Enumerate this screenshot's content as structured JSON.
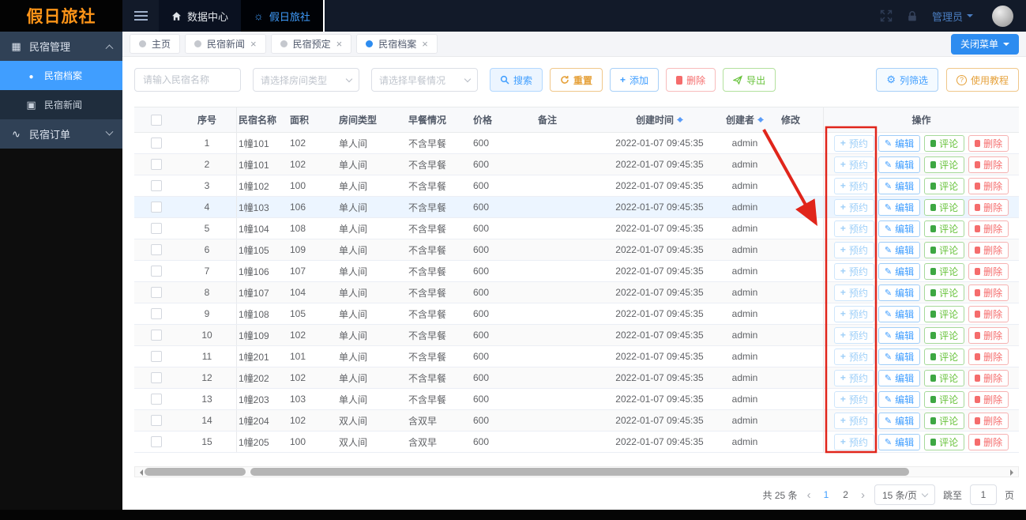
{
  "topbar": {
    "logo": "假日旅社",
    "nav": [
      {
        "label": "数据中心",
        "icon": "home-icon"
      },
      {
        "label": "假日旅社",
        "icon": "sun-icon"
      }
    ],
    "user_label": "管理员"
  },
  "sidebar": {
    "items": [
      {
        "label": "民宿管理",
        "icon": "grid-icon",
        "state": "expanded"
      },
      {
        "label": "民宿档案",
        "icon": "circle-icon",
        "active": true
      },
      {
        "label": "民宿新闻",
        "icon": "news-icon",
        "active": false
      },
      {
        "label": "民宿订单",
        "icon": "pulse-icon",
        "state": "collapsed"
      }
    ]
  },
  "tabsbar": {
    "tabs": [
      {
        "label": "主页",
        "closable": false,
        "active": false
      },
      {
        "label": "民宿新闻",
        "closable": true,
        "active": false
      },
      {
        "label": "民宿预定",
        "closable": true,
        "active": false
      },
      {
        "label": "民宿档案",
        "closable": true,
        "active": true
      }
    ],
    "close_menu_label": "关闭菜单"
  },
  "filters": {
    "name_placeholder": "请输入民宿名称",
    "room_type_placeholder": "请选择房间类型",
    "breakfast_placeholder": "请选择早餐情况",
    "search": "搜索",
    "reset": "重置",
    "add": "添加",
    "delete": "删除",
    "export": "导出",
    "column_filter": "列筛选",
    "tutorial": "使用教程"
  },
  "table": {
    "headers": [
      "序号",
      "民宿名称",
      "面积",
      "房间类型",
      "早餐情况",
      "价格",
      "备注",
      "创建时间",
      "创建者",
      "修改",
      "操作"
    ],
    "actions": {
      "reserve": "预约",
      "edit": "编辑",
      "comment": "评论",
      "del": "删除"
    },
    "rows": [
      {
        "index": "1",
        "name": "1幢101",
        "area": "102",
        "room": "单人间",
        "breakfast": "不含早餐",
        "price": "600",
        "remark": "",
        "created": "2022-01-07 09:45:35",
        "creator": "admin",
        "modified": "",
        "highlight": false
      },
      {
        "index": "2",
        "name": "1幢101",
        "area": "102",
        "room": "单人间",
        "breakfast": "不含早餐",
        "price": "600",
        "remark": "",
        "created": "2022-01-07 09:45:35",
        "creator": "admin",
        "modified": "",
        "highlight": false
      },
      {
        "index": "3",
        "name": "1幢102",
        "area": "100",
        "room": "单人间",
        "breakfast": "不含早餐",
        "price": "600",
        "remark": "",
        "created": "2022-01-07 09:45:35",
        "creator": "admin",
        "modified": "",
        "highlight": false
      },
      {
        "index": "4",
        "name": "1幢103",
        "area": "106",
        "room": "单人间",
        "breakfast": "不含早餐",
        "price": "600",
        "remark": "",
        "created": "2022-01-07 09:45:35",
        "creator": "admin",
        "modified": "",
        "highlight": true
      },
      {
        "index": "5",
        "name": "1幢104",
        "area": "108",
        "room": "单人间",
        "breakfast": "不含早餐",
        "price": "600",
        "remark": "",
        "created": "2022-01-07 09:45:35",
        "creator": "admin",
        "modified": "",
        "highlight": false
      },
      {
        "index": "6",
        "name": "1幢105",
        "area": "109",
        "room": "单人间",
        "breakfast": "不含早餐",
        "price": "600",
        "remark": "",
        "created": "2022-01-07 09:45:35",
        "creator": "admin",
        "modified": "",
        "highlight": false
      },
      {
        "index": "7",
        "name": "1幢106",
        "area": "107",
        "room": "单人间",
        "breakfast": "不含早餐",
        "price": "600",
        "remark": "",
        "created": "2022-01-07 09:45:35",
        "creator": "admin",
        "modified": "",
        "highlight": false
      },
      {
        "index": "8",
        "name": "1幢107",
        "area": "104",
        "room": "单人间",
        "breakfast": "不含早餐",
        "price": "600",
        "remark": "",
        "created": "2022-01-07 09:45:35",
        "creator": "admin",
        "modified": "",
        "highlight": false
      },
      {
        "index": "9",
        "name": "1幢108",
        "area": "105",
        "room": "单人间",
        "breakfast": "不含早餐",
        "price": "600",
        "remark": "",
        "created": "2022-01-07 09:45:35",
        "creator": "admin",
        "modified": "",
        "highlight": false
      },
      {
        "index": "10",
        "name": "1幢109",
        "area": "102",
        "room": "单人间",
        "breakfast": "不含早餐",
        "price": "600",
        "remark": "",
        "created": "2022-01-07 09:45:35",
        "creator": "admin",
        "modified": "",
        "highlight": false
      },
      {
        "index": "11",
        "name": "1幢201",
        "area": "101",
        "room": "单人间",
        "breakfast": "不含早餐",
        "price": "600",
        "remark": "",
        "created": "2022-01-07 09:45:35",
        "creator": "admin",
        "modified": "",
        "highlight": false
      },
      {
        "index": "12",
        "name": "1幢202",
        "area": "102",
        "room": "单人间",
        "breakfast": "不含早餐",
        "price": "600",
        "remark": "",
        "created": "2022-01-07 09:45:35",
        "creator": "admin",
        "modified": "",
        "highlight": false
      },
      {
        "index": "13",
        "name": "1幢203",
        "area": "103",
        "room": "单人间",
        "breakfast": "不含早餐",
        "price": "600",
        "remark": "",
        "created": "2022-01-07 09:45:35",
        "creator": "admin",
        "modified": "",
        "highlight": false
      },
      {
        "index": "14",
        "name": "1幢204",
        "area": "102",
        "room": "双人间",
        "breakfast": "含双早",
        "price": "600",
        "remark": "",
        "created": "2022-01-07 09:45:35",
        "creator": "admin",
        "modified": "",
        "highlight": false
      },
      {
        "index": "15",
        "name": "1幢205",
        "area": "100",
        "room": "双人间",
        "breakfast": "含双早",
        "price": "600",
        "remark": "",
        "created": "2022-01-07 09:45:35",
        "creator": "admin",
        "modified": "",
        "highlight": false
      }
    ]
  },
  "pagination": {
    "total_label": "共 25 条",
    "pages": [
      "1",
      "2"
    ],
    "active_page": "1",
    "page_size_label": "15 条/页",
    "jump_label": "跳至",
    "jump_value": "1",
    "page_unit": "页"
  },
  "colors": {
    "accent": "#409eff",
    "success": "#67c23a",
    "warning": "#e6a23c",
    "danger": "#f56c6c",
    "topbar": "#121a29",
    "sidebar_item": "#304156",
    "annotation": "#e0251b"
  }
}
